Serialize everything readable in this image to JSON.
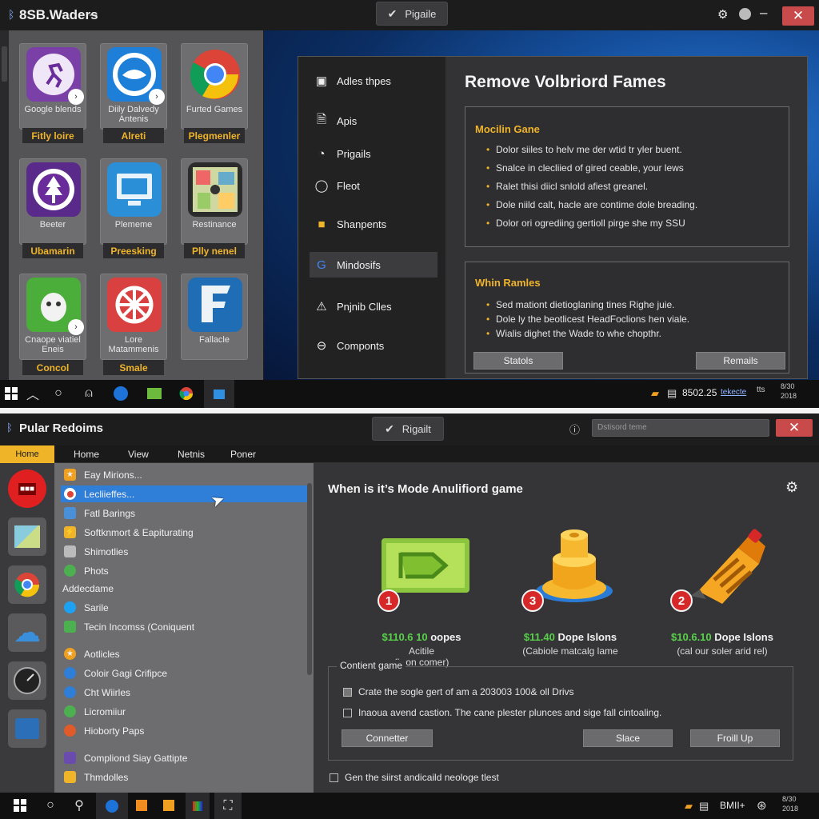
{
  "top_window": {
    "title": "8SB.Waders",
    "title_dash": "–",
    "center_button": "Pigaile",
    "close": "✕",
    "store_tiles": [
      {
        "name": "Google blends",
        "tag": "Fitly loire",
        "icon": "running-figure-icon",
        "color": "#7b3fa8"
      },
      {
        "name": "Diily Dalvedy Antenis",
        "tag": "Alreti",
        "icon": "bird-icon",
        "color": "#1e7fd8"
      },
      {
        "name": "Furted Games",
        "tag": "Plegmenler",
        "icon": "chrome-icon",
        "color": "#ffffff"
      },
      {
        "name": "Beeter",
        "tag": "Ubamarin",
        "icon": "tree-icon",
        "color": "#5a2a8a"
      },
      {
        "name": "Plememe",
        "tag": "Preesking",
        "icon": "monitor-icon",
        "color": "#2a8fd6"
      },
      {
        "name": "Restinance",
        "tag": "Plly nenel",
        "icon": "map-icon",
        "color": "#2b2b2b"
      },
      {
        "name": "Cnaope viatiel Eneis",
        "tag": "Concol",
        "icon": "android-icon",
        "color": "#4cae3a"
      },
      {
        "name": "Lore Matammenis",
        "tag": "Smale",
        "icon": "wheel-icon",
        "color": "#d94040"
      },
      {
        "name": "Fallacle",
        "tag": "",
        "icon": "letter-e-icon",
        "color": "#1f6db5"
      }
    ],
    "dialog": {
      "nav": [
        {
          "label": "Adles thpes",
          "icon": "window-icon"
        },
        {
          "label": "Apis",
          "icon": "document-icon"
        },
        {
          "label": "Prigails",
          "icon": "timer-icon"
        },
        {
          "label": "Fleot",
          "icon": "chat-icon"
        },
        {
          "label": "Shanpents",
          "icon": "folder-icon"
        },
        {
          "label": "Mindosifs",
          "icon": "google-icon"
        },
        {
          "label": "Pnjnib Clles",
          "icon": "warning-icon"
        },
        {
          "label": "Componts",
          "icon": "minus-circle-icon"
        }
      ],
      "active_nav": 5,
      "title": "Remove Volbriord Fames",
      "section1": {
        "heading": "Mocilin Gane",
        "bullets": [
          "Dolor siiles to helv me der wtid tr yler buent.",
          "Snalce in clecliied of gired ceable, your lews",
          "Ralet thisi diicl snlold afiest greanel.",
          "Dole niild calt, hacle are contime dole breading.",
          "Dolor ori ogrediing gertioll pirge she my SSU"
        ]
      },
      "section2": {
        "heading": "Whin Ramles",
        "bullets": [
          "Sed mationt dietioglaning tines Righe juie.",
          "Dole ly the beotlicest HeadFoclions hen viale.",
          "Wialis dighet the Wade to whe chopthr."
        ]
      },
      "btn_left": "Statols",
      "btn_right": "Remails"
    },
    "taskbar": {
      "tray_text": "8502.25",
      "tray_link": "tekecte",
      "tray_label": "tts",
      "clock_time": "8/30",
      "clock_date": "2018"
    }
  },
  "bottom_window": {
    "title": "Pular Redoims",
    "center_button": "Rigailt",
    "search_placeholder": "Dstisord teme",
    "close": "✕",
    "menu": [
      "Home",
      "Home",
      "View",
      "Netnis",
      "Poner"
    ],
    "list": [
      {
        "label": "Eay Mirions...",
        "icon": "star-icon",
        "color": "#f0a020"
      },
      {
        "label": "Lecliieffes...",
        "icon": "chrome-icon",
        "color": "#ffffff",
        "selected": true
      },
      {
        "label": "Fatl Barings",
        "icon": "image-icon",
        "color": "#4a90d9"
      },
      {
        "label": "Softknmort & Eapiturating",
        "icon": "bolt-icon",
        "color": "#f0b429"
      },
      {
        "label": "Shimotlies",
        "icon": "grid-icon",
        "color": "#bbbbbb"
      },
      {
        "label": "Phots",
        "icon": "leaf-icon",
        "color": "#4caf50"
      },
      {
        "label": "Addecdame",
        "section": true
      },
      {
        "label": "Sarile",
        "icon": "bird-icon",
        "color": "#1da1f2"
      },
      {
        "label": "Tecin Incomss (Coniquent",
        "icon": "chat-icon",
        "color": "#4caf50"
      },
      {
        "label": "Aotlicles",
        "icon": "star-icon",
        "color": "#f0a020"
      },
      {
        "label": "Coloir Gagi Crifipce",
        "icon": "globe-icon",
        "color": "#2f7ed8"
      },
      {
        "label": "Cht Wiirles",
        "icon": "globe-icon",
        "color": "#2f7ed8"
      },
      {
        "label": "Licromiiur",
        "icon": "circle-icon",
        "color": "#4caf50"
      },
      {
        "label": "Hioborty Paps",
        "icon": "flame-icon",
        "color": "#e05a2a"
      },
      {
        "label": "Compliond Siay Gattipte",
        "icon": "lock-icon",
        "color": "#6a4caf"
      },
      {
        "label": "Thmdolles",
        "icon": "paint-icon",
        "color": "#f0b429"
      }
    ],
    "rail_icons": [
      {
        "icon": "app-red-icon",
        "color": "#e02020"
      },
      {
        "icon": "map-icon",
        "color": "#5aa0c8"
      },
      {
        "icon": "chrome-icon",
        "color": "#e8e8e8"
      },
      {
        "icon": "cloud-icon",
        "color": "#3a8fdc"
      },
      {
        "icon": "gauge-icon",
        "color": "#222222"
      },
      {
        "icon": "box-icon",
        "color": "#2a6fb8"
      }
    ],
    "main": {
      "heading": "When is it’s Mode Anulifiord game",
      "offers": [
        {
          "num": "1",
          "price": "$110.6 10",
          "price_suffix": "oopes",
          "sub1": "Acitile",
          "sub2": "(bron comer)",
          "art": "ticket-icon"
        },
        {
          "num": "3",
          "price": "$11.40",
          "price_suffix": "Dope Islons",
          "sub1": "(Cabiole matcalg lame",
          "sub2": "",
          "art": "button-icon"
        },
        {
          "num": "2",
          "price": "$10.6.10",
          "price_suffix": "Dope Islons",
          "sub1": "(cal our soler arid rel)",
          "sub2": "",
          "art": "tool-icon"
        }
      ],
      "content_legend": "Contient game",
      "checks": [
        {
          "label": "Crate the sogle gert of am a 203003 100& oll Drivs",
          "checked": true
        },
        {
          "label": "Inaoua avend castion. The cane plester plunces and sige fall cintoaling.",
          "checked": false
        }
      ],
      "btn1": "Connetter",
      "btn2": "Slace",
      "btn3": "Froill Up",
      "footer_check": "Gen the siirst andicaild neologe tlest"
    },
    "taskbar": {
      "tray_text": "BMII+",
      "clock_time": "8/30",
      "clock_date": "2018"
    }
  }
}
